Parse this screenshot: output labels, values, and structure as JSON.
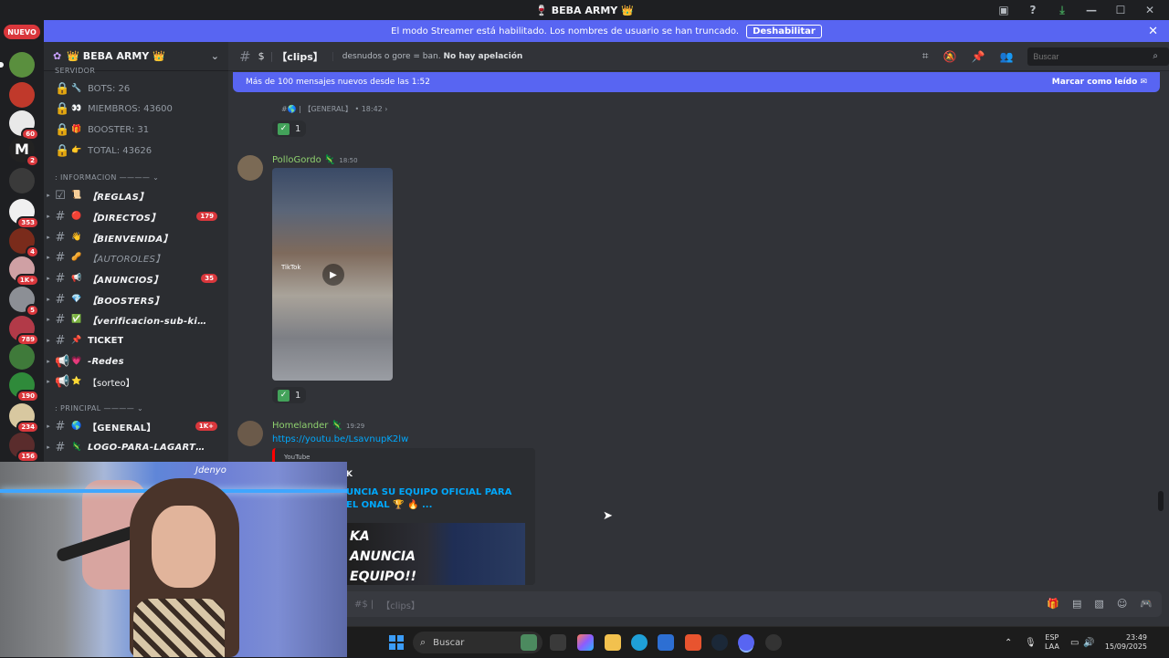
{
  "window": {
    "title": "🍷 BEBA ARMY 👑"
  },
  "rail": {
    "new_label": "NUEVO",
    "badges": [
      "60",
      "2",
      "353",
      "4",
      "1K+",
      "5",
      "789",
      "190",
      "234",
      "156"
    ]
  },
  "banner": {
    "text": "El modo Streamer está habilitado. Los nombres de usuario se han truncado.",
    "button": "Deshabilitar"
  },
  "server": {
    "name": "👑 BEBA ARMY 👑"
  },
  "sidebar": {
    "cat_server": "SERVIDOR",
    "stats": [
      {
        "emoji": "🔧",
        "label": "BOTS: 26"
      },
      {
        "emoji": "👀",
        "label": "MIEMBROS: 43600"
      },
      {
        "emoji": "🎁",
        "label": "BOOSTER: 31"
      },
      {
        "emoji": "👉",
        "label": "TOTAL: 43626"
      }
    ],
    "cat_info": ": INFORMACION ———— ⌄",
    "info_channels": [
      {
        "emoji": "📜",
        "label": "【REGLAS】",
        "count": ""
      },
      {
        "emoji": "🔴",
        "label": "【DIRECTOS】",
        "count": "179"
      },
      {
        "emoji": "👋",
        "label": "【BIENVENIDA】",
        "count": ""
      },
      {
        "emoji": "🥜",
        "label": "【AUTOROLES】",
        "count": ""
      },
      {
        "emoji": "📢",
        "label": "【ANUNCIOS】",
        "count": "35"
      },
      {
        "emoji": "💎",
        "label": "【BOOSTERS】",
        "count": ""
      },
      {
        "emoji": "✅",
        "label": "【verificacion-sub-kic...",
        "count": ""
      },
      {
        "emoji": "📌",
        "label": "TICKET",
        "count": ""
      },
      {
        "emoji": "💗",
        "label": "-Redes",
        "count": ""
      },
      {
        "emoji": "⭐",
        "label": "【sorteo】",
        "count": ""
      }
    ],
    "cat_principal": ": PRINCIPAL ———— ⌄",
    "principal_channels": [
      {
        "emoji": "🌎",
        "label": "【GENERAL】",
        "count": "1K+"
      },
      {
        "emoji": "",
        "label": "LOGO-PARA-LAGARTO-S...",
        "count": ""
      }
    ]
  },
  "chat": {
    "channel_prefix": "$",
    "channel_name": "【clips】",
    "topic": "desnudos o gore = ban.",
    "topic_bold": "No hay apelación",
    "search_placeholder": "Buscar",
    "new_messages": "Más de 100 mensajes nuevos desde las 1:52",
    "mark_read": "Marcar como leído",
    "forward_ref": "#🌎 | 【GENERAL】 • 18:42 ›",
    "messages": [
      {
        "author": "PolloGordo 🦎",
        "time": "18:50",
        "reaction_count": "1"
      },
      {
        "author": "Homelander 🦎",
        "time": "19:29",
        "link": "https://youtu.be/LsavnupK2lw",
        "embed_provider": "YouTube",
        "embed_author": "K",
        "embed_title": "UNCIA SU EQUIPO OFICIAL PARA EL ONAL 🏆 🔥 ...",
        "thumb_text": "KA ANUNCIA EQUIPO!!"
      }
    ],
    "reaction_top_count": "1",
    "tiktok_label": "TikTok",
    "composer_placeholder": "【clips】"
  },
  "webcam": {
    "overlay_text": "Jdenyo"
  },
  "taskbar": {
    "search": "Buscar",
    "lang_top": "ESP",
    "lang_bottom": "LAA",
    "time": "23:49",
    "date": "15/09/2025"
  }
}
